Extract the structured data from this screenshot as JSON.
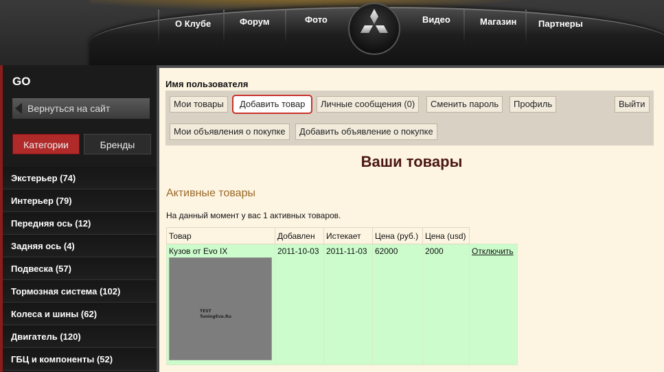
{
  "nav": {
    "items": [
      "О Клубе",
      "Форум",
      "Фото",
      "Видео",
      "Магазин",
      "Партнеры"
    ]
  },
  "sidebar": {
    "go_label": "GO",
    "back_label": "Вернуться на сайт",
    "tabs": {
      "categories": "Категории",
      "brands": "Бренды"
    },
    "categories": [
      "Экстерьер (74)",
      "Интерьер (79)",
      "Передняя ось (12)",
      "Задняя ось (4)",
      "Подвеска (57)",
      "Тормозная система (102)",
      "Колеса и шины (62)",
      "Двигатель (120)",
      "ГБЦ и компоненты (52)"
    ]
  },
  "main": {
    "username": "Имя пользователя",
    "toolbar": {
      "my_goods": "Мои товары",
      "add_good": "Добавить товар",
      "messages": "Личные сообщения (0)",
      "change_password": "Сменить пароль",
      "profile": "Профиль",
      "logout": "Выйти",
      "my_purchase_ads": "Мои объявления о покупке",
      "add_purchase_ad": "Добавить объявление о покупке"
    },
    "heading": "Ваши товары",
    "section_title": "Активные товары",
    "info": "На данный момент у вас 1 активных товаров.",
    "table": {
      "headers": [
        "Товар",
        "Добавлен",
        "Истекает",
        "Цена (руб.)",
        "Цена (usd)"
      ],
      "rows": [
        {
          "product": "Кузов от Evo IX",
          "added": "2011-10-03",
          "expires": "2011-11-03",
          "price_rub": "62000",
          "price_usd": "2000",
          "action": "Отключить",
          "thumb_text": [
            "TEST",
            "TuningEvo.Ru"
          ]
        }
      ]
    }
  },
  "colors": {
    "accent_red": "#b12a2a",
    "heading": "#4a1610",
    "row_bg": "#ccfccc",
    "panel_bg": "#fdf4e2"
  }
}
